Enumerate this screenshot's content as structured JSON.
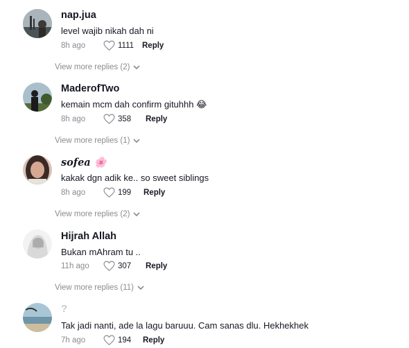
{
  "comments": [
    {
      "username": "nap.jua",
      "text": "level wajib nikah dah ni",
      "time": "8h ago",
      "likes": "1111",
      "reply_label": "Reply",
      "view_more": "View more replies (2)",
      "avatar_colors": [
        "#5b6a73",
        "#b9c3c9"
      ]
    },
    {
      "username": "MaderofTwo",
      "text": "kemain mcm dah confirm gituhhh",
      "emoji": "😂",
      "time": "8h ago",
      "likes": "358",
      "reply_label": "Reply",
      "view_more": "View more replies (1)",
      "avatar_colors": [
        "#9fb4c2",
        "#2f3b2a"
      ]
    },
    {
      "username": "𝒔𝒐𝒇𝒆𝒂",
      "emoji": "🌸",
      "text": "kakak dgn adik ke.. so sweet siblings",
      "time": "8h ago",
      "likes": "199",
      "reply_label": "Reply",
      "view_more": "View more replies (2)",
      "avatar_colors": [
        "#b68a7e",
        "#3e2c2a"
      ]
    },
    {
      "username": "Hijrah Allah",
      "text": "Bukan mAhram tu ..",
      "time": "11h ago",
      "likes": "307",
      "reply_label": "Reply",
      "view_more": "View more replies (11)",
      "avatar_colors": [
        "#e6e6e6",
        "#9a9a9a"
      ]
    },
    {
      "username": "?",
      "text": "Tak jadi nanti, ade la lagu baruuu. Cam sanas dlu. Hekhekhek",
      "time": "7h ago",
      "likes": "194",
      "reply_label": "Reply",
      "avatar_colors": [
        "#8fb2c4",
        "#c9b99a"
      ]
    }
  ],
  "colors": {
    "text_primary": "#161823",
    "text_secondary": "#8a8b91"
  }
}
